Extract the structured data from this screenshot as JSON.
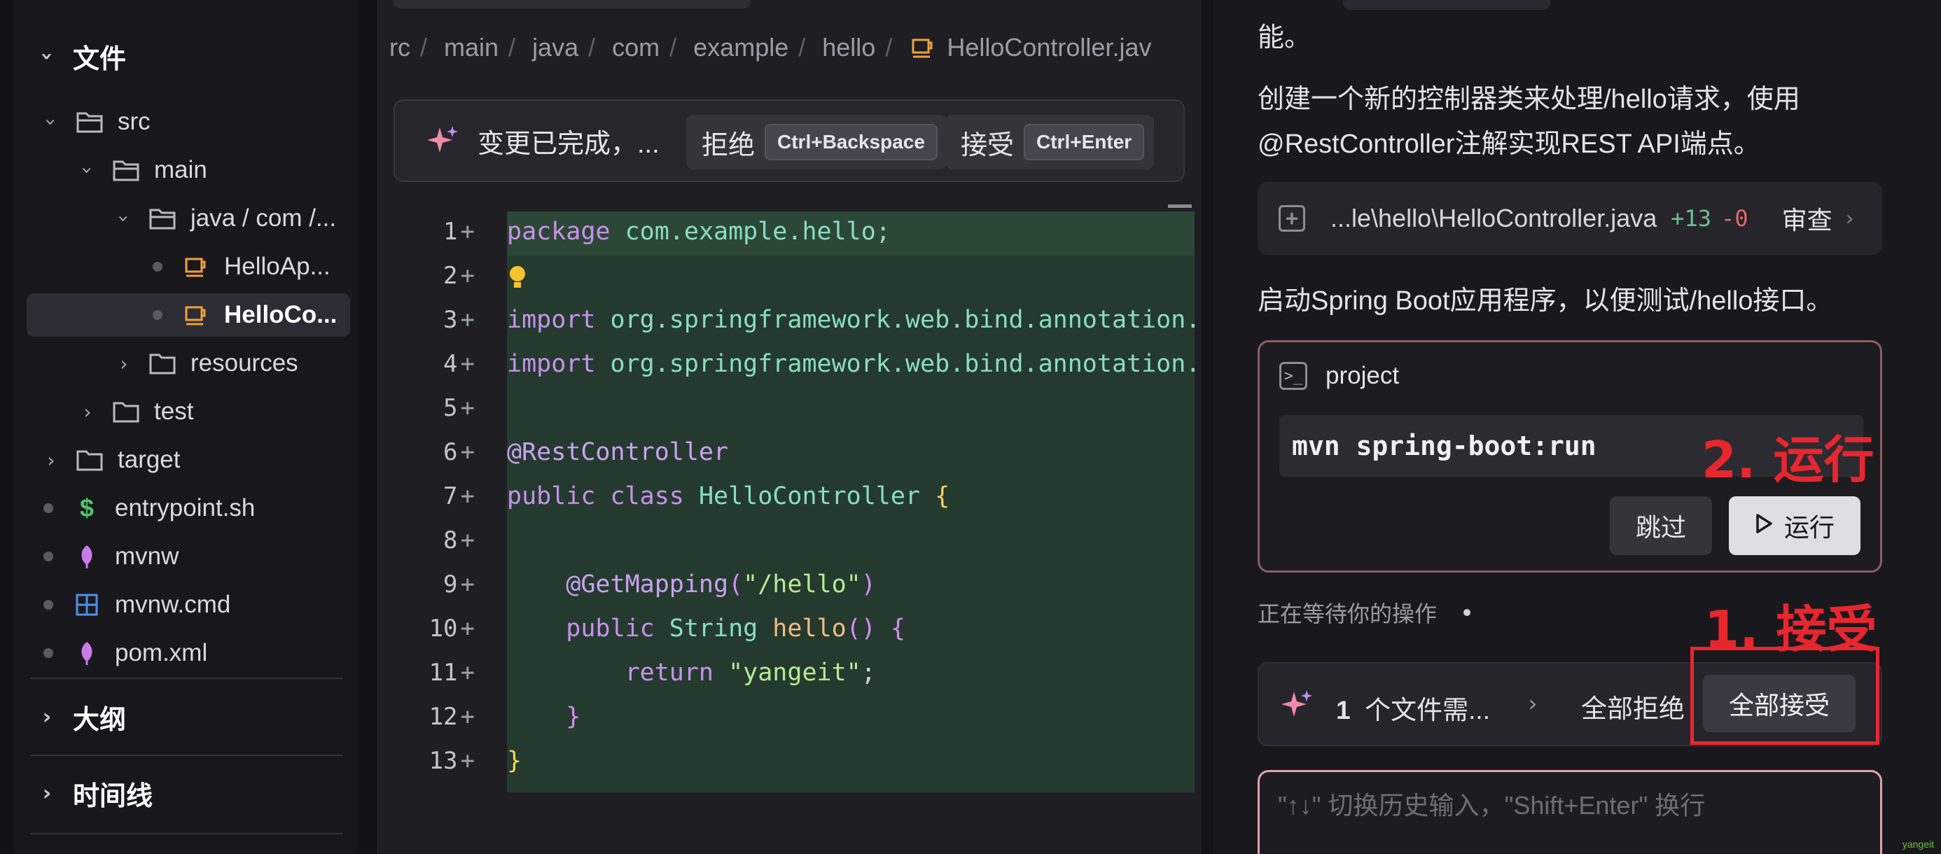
{
  "sidebar": {
    "files_header": "文件",
    "outline_header": "大纲",
    "timeline_header": "时间线",
    "tree": [
      {
        "label": "src"
      },
      {
        "label": "main"
      },
      {
        "label": "java / com /..."
      },
      {
        "label": "HelloAp..."
      },
      {
        "label": "HelloCo..."
      },
      {
        "label": "resources"
      },
      {
        "label": "test"
      },
      {
        "label": "target"
      },
      {
        "label": "entrypoint.sh"
      },
      {
        "label": "mvnw"
      },
      {
        "label": "mvnw.cmd"
      },
      {
        "label": "pom.xml"
      }
    ]
  },
  "editor": {
    "breadcrumb": [
      "rc",
      "main",
      "java",
      "com",
      "example",
      "hello"
    ],
    "breadcrumb_file": "HelloController.jav",
    "diff_message": "变更已完成，...",
    "reject_label": "拒绝",
    "reject_shortcut": "Ctrl+Backspace",
    "accept_label": "接受",
    "accept_shortcut": "Ctrl+Enter",
    "line_numbers": [
      "1",
      "2",
      "3",
      "4",
      "5",
      "6",
      "7",
      "8",
      "9",
      "10",
      "11",
      "12",
      "13"
    ],
    "code": {
      "l1_kw": "package",
      "l1_rest": " com.example.hello;",
      "l3_kw": "import",
      "l3_rest": " org.springframework.web.bind.annotation.GetMapping;",
      "l4_kw": "import",
      "l4_rest": " org.springframework.web.bind.annotation.RestController;",
      "l6": "@RestController",
      "l7_kw1": "public",
      "l7_kw2": " class",
      "l7_cls": " HelloController",
      "l7_br": " {",
      "l9_an": "    @GetMapping",
      "l9_p1": "(",
      "l9_str": "\"/hello\"",
      "l9_p2": ")",
      "l10_kw": "    public",
      "l10_type": " String",
      "l10_fn": " hello",
      "l10_p": "()",
      "l10_br": " {",
      "l11_kw": "        return",
      "l11_str": " \"yangeit\"",
      "l11_end": ";",
      "l12": "    }",
      "l13": "}"
    }
  },
  "chat": {
    "para0": "能。",
    "para1_a": "创建一个新的控制器类来处理/hello请求，使用",
    "para1_b": "@RestController注解实现REST API端点。",
    "file_path": "...le\\hello\\HelloController.java",
    "additions": "+13",
    "deletions": "-0",
    "review_label": "审查",
    "para2": "启动Spring Boot应用程序，以便测试/hello接口。",
    "terminal_title": "project",
    "command": "mvn spring-boot:run",
    "skip_label": "跳过",
    "run_label": "运行",
    "waiting_text": "正在等待你的操作",
    "pending_count": "1",
    "pending_text": "个文件需...",
    "reject_all": "全部拒绝",
    "accept_all": "全部接受",
    "input_placeholder": "\"↑↓\" 切换历史输入，\"Shift+Enter\" 换行"
  },
  "annotations": {
    "step2": "2. 运行",
    "step1": "1. 接受",
    "watermark": "yangeit"
  },
  "colors": {
    "accent_annotation": "#e8262e",
    "diff_added_bg": "#253a2f",
    "additions": "#71c08a",
    "deletions": "#e06b6b"
  }
}
